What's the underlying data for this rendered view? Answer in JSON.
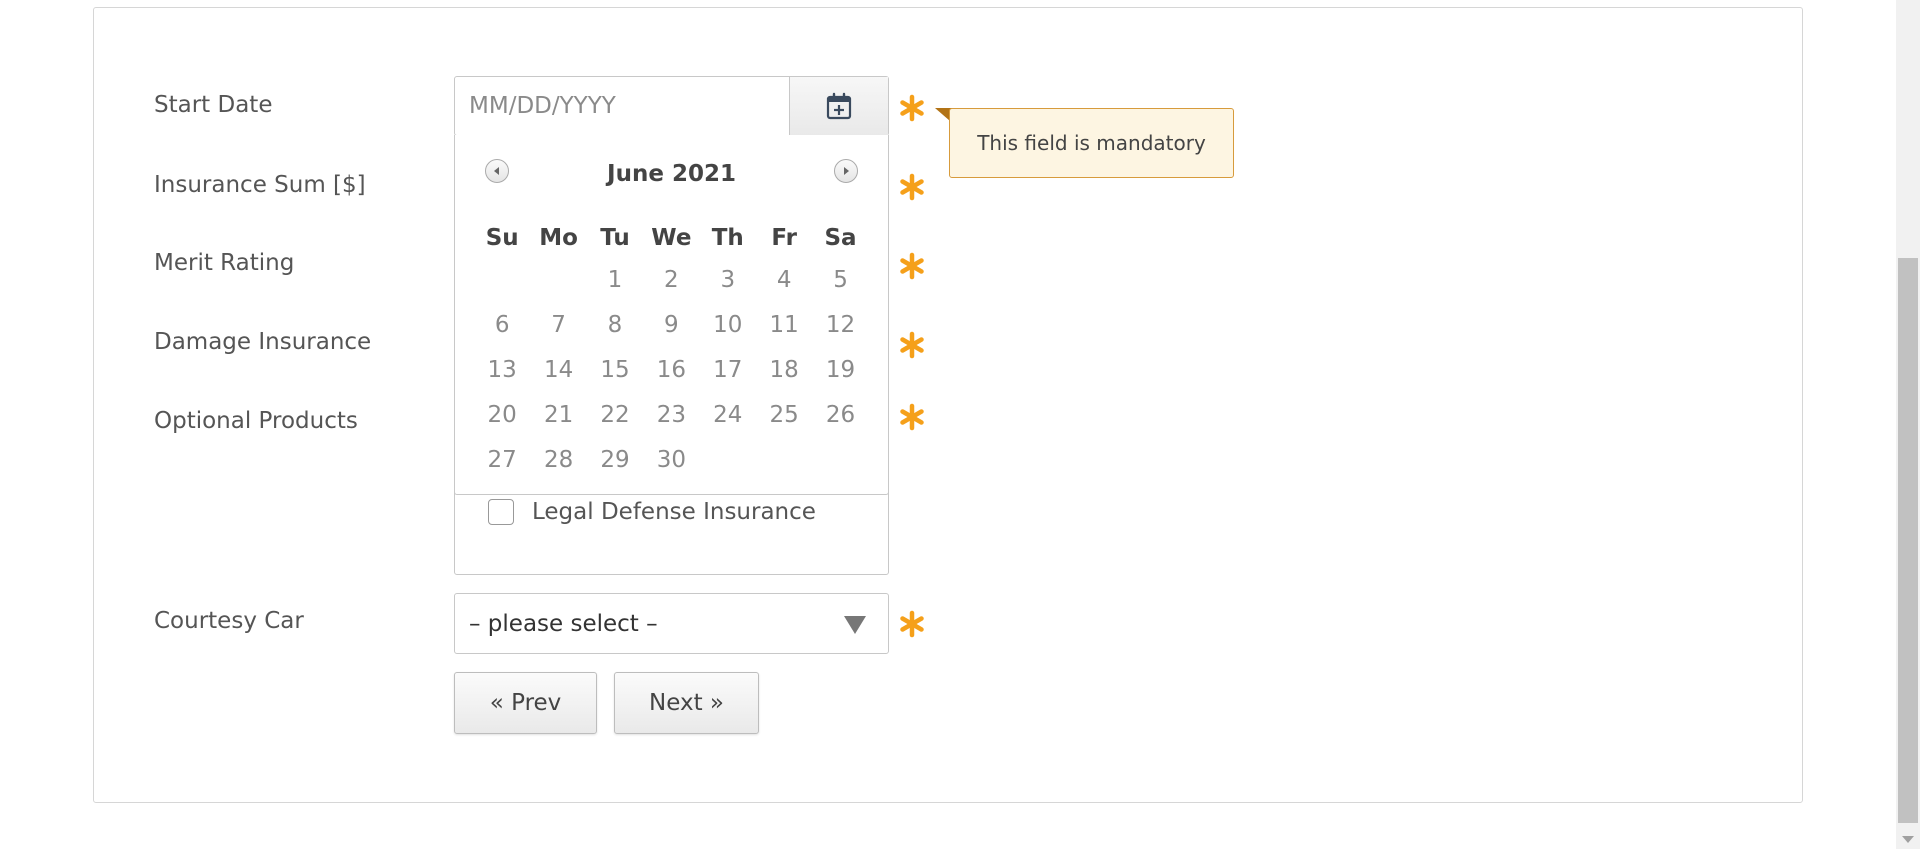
{
  "form": {
    "start_date_label": "Start Date",
    "insurance_sum_label": "Insurance Sum [$]",
    "merit_rating_label": "Merit Rating",
    "damage_insurance_label": "Damage Insurance",
    "optional_products_label": "Optional Products",
    "courtesy_car_label": "Courtesy Car",
    "date_placeholder": "MM/DD/YYYY",
    "date_value": "",
    "mandatory_tooltip": "This field is mandatory",
    "legal_defense_label": "Legal Defense Insurance",
    "courtesy_car_selected": "– please select –",
    "prev_label": "« Prev",
    "next_label": "Next »"
  },
  "calendar": {
    "title": "June 2021",
    "weekdays": [
      "Su",
      "Mo",
      "Tu",
      "We",
      "Th",
      "Fr",
      "Sa"
    ],
    "weeks": [
      [
        "",
        "",
        "1",
        "2",
        "3",
        "4",
        "5"
      ],
      [
        "6",
        "7",
        "8",
        "9",
        "10",
        "11",
        "12"
      ],
      [
        "13",
        "14",
        "15",
        "16",
        "17",
        "18",
        "19"
      ],
      [
        "20",
        "21",
        "22",
        "23",
        "24",
        "25",
        "26"
      ],
      [
        "27",
        "28",
        "29",
        "30",
        "",
        "",
        ""
      ]
    ]
  },
  "icons": {
    "required": "asterisk-icon",
    "calendar": "calendar-plus-icon",
    "prev_month": "chevron-left-icon",
    "next_month": "chevron-right-icon",
    "dropdown": "chevron-down-icon"
  },
  "colors": {
    "required_asterisk": "#f5a01a",
    "tooltip_bg": "#fdf5e2",
    "tooltip_border": "#d79b3c"
  }
}
